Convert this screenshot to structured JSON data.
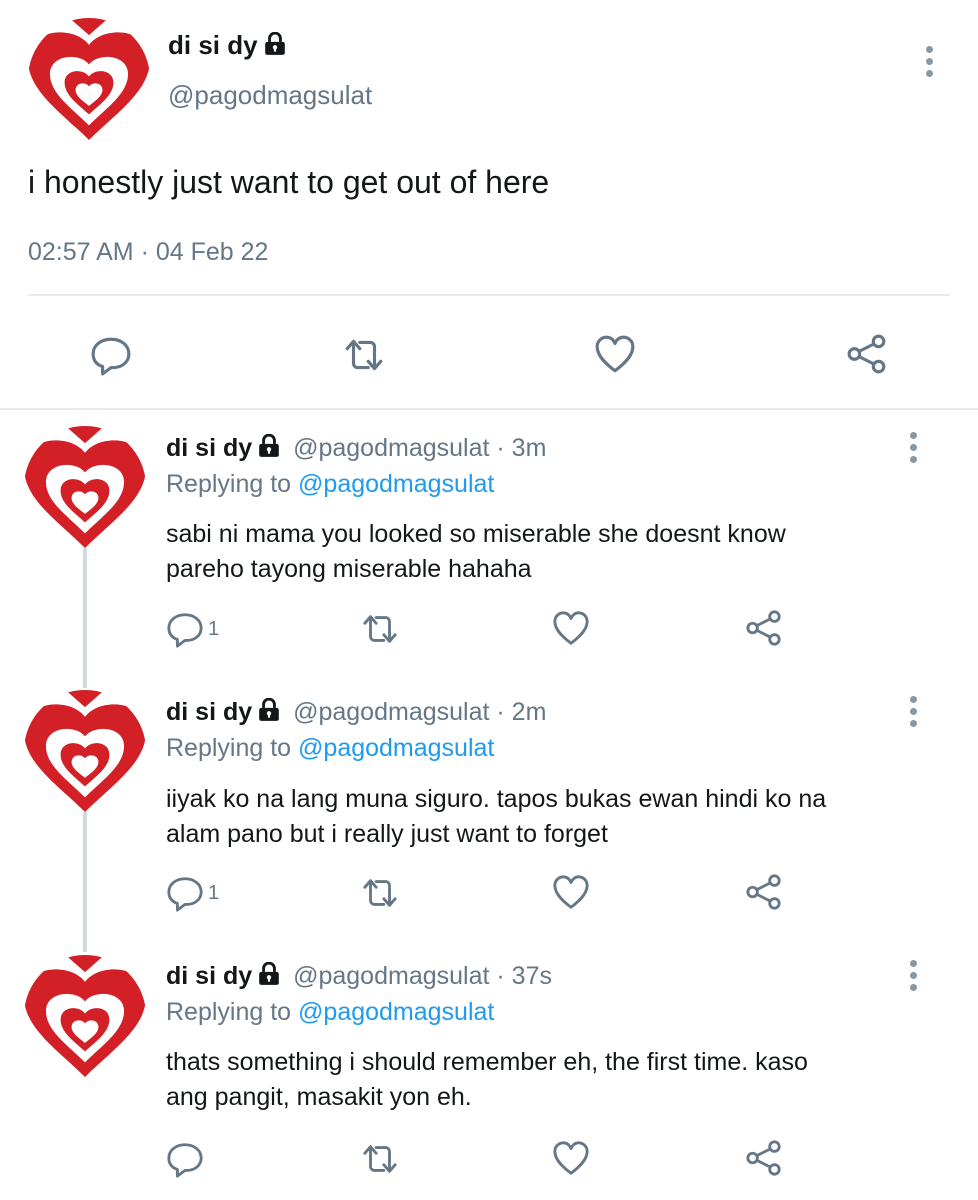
{
  "main_tweet": {
    "display_name": "di si dy",
    "handle": "@pagodmagsulat",
    "text": "i honestly just want to get out of here",
    "timestamp": "02:57 AM · 04 Feb 22"
  },
  "replies": [
    {
      "display_name": "di si dy",
      "handle": "@pagodmagsulat",
      "time": "· 3m",
      "replying_label": "Replying to",
      "replying_to": "@pagodmagsulat",
      "line1": "sabi ni mama you looked so miserable she doesnt know",
      "line2": "pareho tayong miserable hahaha",
      "reply_count": "1"
    },
    {
      "display_name": "di si dy",
      "handle": "@pagodmagsulat",
      "time": "· 2m",
      "replying_label": "Replying to",
      "replying_to": "@pagodmagsulat",
      "line1": "iiyak ko na lang muna siguro. tapos bukas ewan hindi ko na",
      "line2": "alam pano but i really just want to forget",
      "reply_count": "1"
    },
    {
      "display_name": "di si dy",
      "handle": "@pagodmagsulat",
      "time": "· 37s",
      "replying_label": "Replying to",
      "replying_to": "@pagodmagsulat",
      "line1": "thats something i should remember eh, the first time. kaso",
      "line2": "ang pangit, masakit yon eh.",
      "reply_count": ""
    }
  ],
  "colors": {
    "accent": "#1d9bf0",
    "muted": "#657786",
    "avatar_red": "#d31f26",
    "divider": "#e6ecf0"
  },
  "icons": [
    "lock-icon",
    "more-icon",
    "reply-icon",
    "retweet-icon",
    "like-icon",
    "share-icon"
  ]
}
